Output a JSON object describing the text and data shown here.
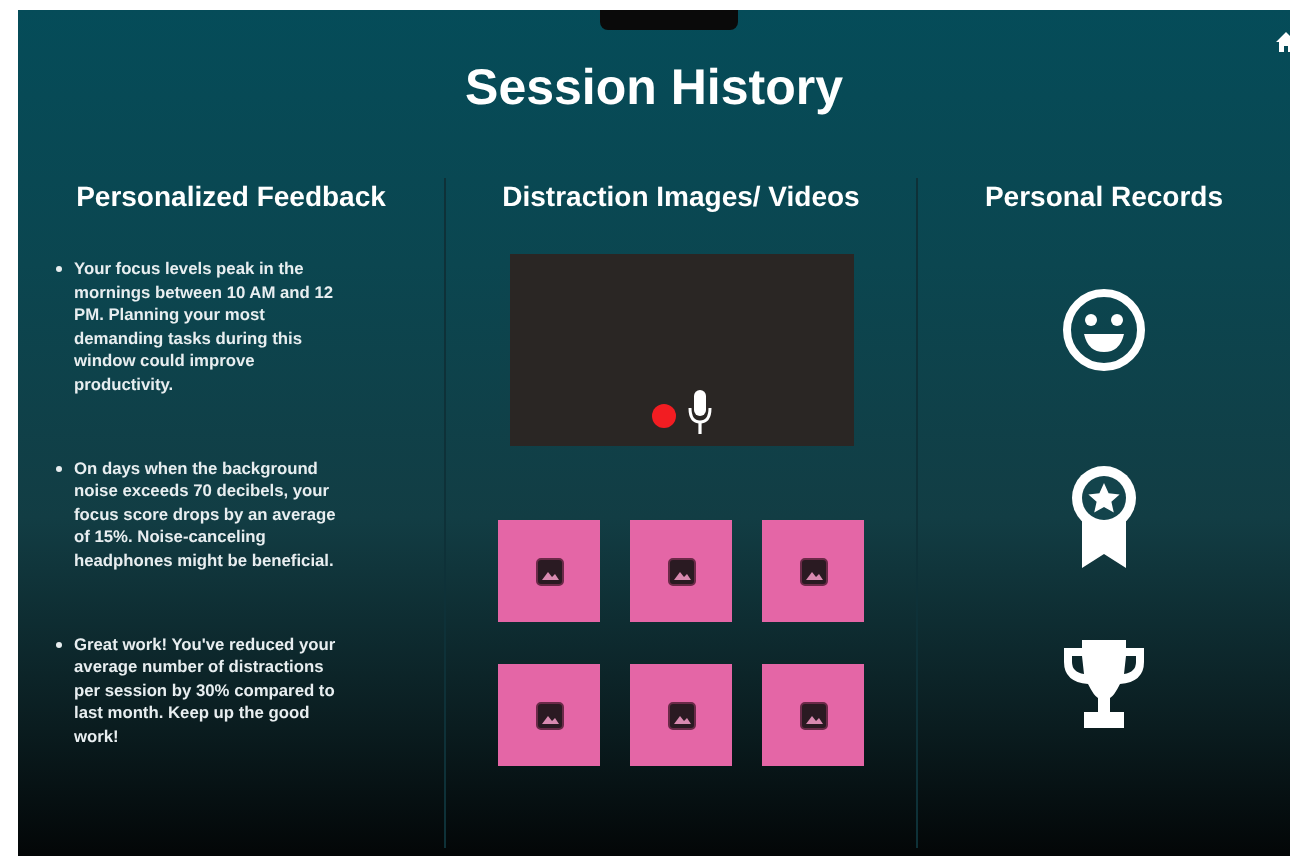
{
  "title": "Session History",
  "feedback": {
    "heading": "Personalized Feedback",
    "items": [
      "Your focus levels peak in the mornings between 10 AM and 12 PM. Planning your most demanding tasks during this window could improve productivity.",
      "On days when the background noise exceeds 70 decibels, your focus score drops by an average of 15%. Noise-canceling headphones might be beneficial.",
      "Great work! You've reduced your average number of distractions per session by 30% compared to last month. Keep up the good work!"
    ]
  },
  "media": {
    "heading": "Distraction Images/ Videos",
    "video": {
      "recording": true
    },
    "thumbnails": [
      {
        "kind": "image"
      },
      {
        "kind": "image"
      },
      {
        "kind": "image"
      },
      {
        "kind": "image"
      },
      {
        "kind": "image"
      },
      {
        "kind": "image"
      }
    ]
  },
  "records": {
    "heading": "Personal Records",
    "items": [
      {
        "kind": "smiley"
      },
      {
        "kind": "badge"
      },
      {
        "kind": "trophy"
      }
    ]
  }
}
